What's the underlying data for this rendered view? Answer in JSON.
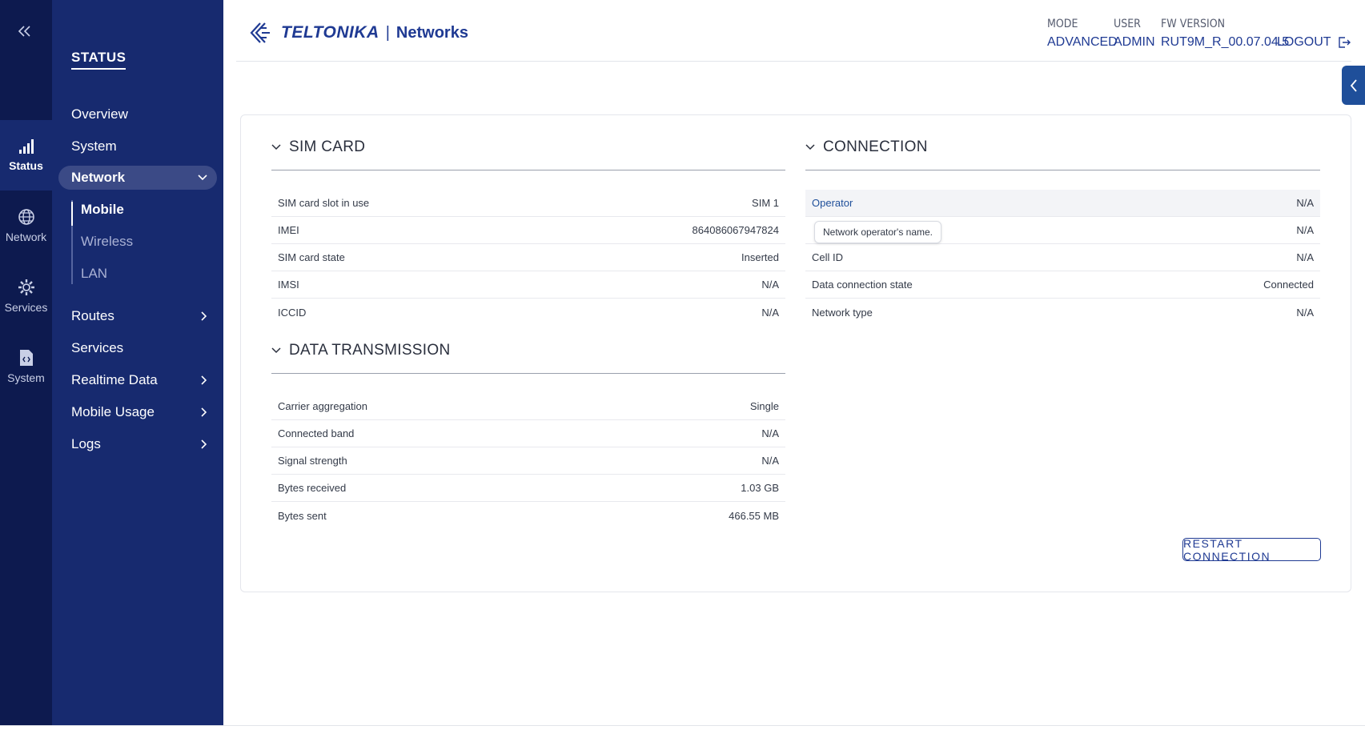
{
  "rail": {
    "items": [
      {
        "label": "Status",
        "icon": "signal-bars-icon",
        "active": true
      },
      {
        "label": "Network",
        "icon": "globe-icon",
        "active": false
      },
      {
        "label": "Services",
        "icon": "gear-icon",
        "active": false
      },
      {
        "label": "System",
        "icon": "file-code-icon",
        "active": false
      }
    ]
  },
  "nav": {
    "section_title": "STATUS",
    "items": [
      {
        "label": "Overview"
      },
      {
        "label": "System"
      },
      {
        "label": "Network"
      },
      {
        "label": "Routes"
      },
      {
        "label": "Services"
      },
      {
        "label": "Realtime Data"
      },
      {
        "label": "Mobile Usage"
      },
      {
        "label": "Logs"
      }
    ],
    "network_sub": [
      {
        "label": "Mobile",
        "active": true
      },
      {
        "label": "Wireless",
        "active": false
      },
      {
        "label": "LAN",
        "active": false
      }
    ]
  },
  "header": {
    "brand": "TELTONIKA",
    "separator": "|",
    "product": "Networks",
    "mode_label": "MODE",
    "mode_value": "ADVANCED",
    "user_label": "USER",
    "user_value": "ADMIN",
    "fw_label": "FW VERSION",
    "fw_value": "RUT9M_R_00.07.04.5",
    "logout": "LOGOUT"
  },
  "sim_card": {
    "title": "SIM CARD",
    "rows": [
      {
        "label": "SIM card slot in use",
        "value": "SIM 1"
      },
      {
        "label": "IMEI",
        "value": "864086067947824"
      },
      {
        "label": "SIM card state",
        "value": "Inserted"
      },
      {
        "label": "IMSI",
        "value": "N/A"
      },
      {
        "label": "ICCID",
        "value": "N/A"
      }
    ]
  },
  "data_transmission": {
    "title": "DATA TRANSMISSION",
    "rows": [
      {
        "label": "Carrier aggregation",
        "value": "Single"
      },
      {
        "label": "Connected band",
        "value": "N/A"
      },
      {
        "label": "Signal strength",
        "value": "N/A"
      },
      {
        "label": "Bytes received",
        "value": "1.03 GB"
      },
      {
        "label": "Bytes sent",
        "value": "466.55 MB"
      }
    ]
  },
  "connection": {
    "title": "CONNECTION",
    "rows": [
      {
        "label": "Operator",
        "value": "N/A"
      },
      {
        "label": "",
        "value": "N/A"
      },
      {
        "label": "Cell ID",
        "value": "N/A"
      },
      {
        "label": "Data connection state",
        "value": "Connected"
      },
      {
        "label": "Network type",
        "value": "N/A"
      }
    ],
    "tooltip": "Network operator's name.",
    "restart_button": "RESTART CONNECTION"
  }
}
